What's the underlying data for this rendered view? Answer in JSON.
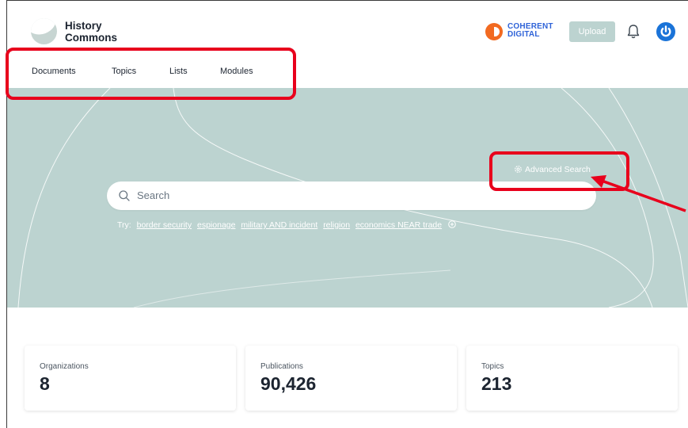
{
  "header": {
    "logo_line1": "History",
    "logo_line2": "Commons",
    "partner_line1": "COHERENT",
    "partner_line2": "DIGITAL",
    "upload_label": "Upload"
  },
  "nav": {
    "items": [
      {
        "label": "Documents"
      },
      {
        "label": "Topics"
      },
      {
        "label": "Lists"
      },
      {
        "label": "Modules"
      }
    ]
  },
  "search": {
    "placeholder": "Search",
    "advanced_label": "Advanced Search",
    "try_label": "Try:",
    "suggestions": [
      "border security",
      "espionage",
      "military AND incident",
      "religion",
      "economics NEAR trade"
    ]
  },
  "stats": [
    {
      "label": "Organizations",
      "value": "8"
    },
    {
      "label": "Publications",
      "value": "90,426"
    },
    {
      "label": "Topics",
      "value": "213"
    }
  ],
  "colors": {
    "hero_bg": "#bcd3d0",
    "annotation_red": "#e8001c",
    "brand_blue": "#1a73d8",
    "partner_orange": "#f26a21"
  },
  "icons": [
    "logo-icon",
    "coherent-digital-logo-icon",
    "bell-icon",
    "power-icon",
    "search-icon",
    "gear-icon",
    "circle-plus-icon"
  ]
}
